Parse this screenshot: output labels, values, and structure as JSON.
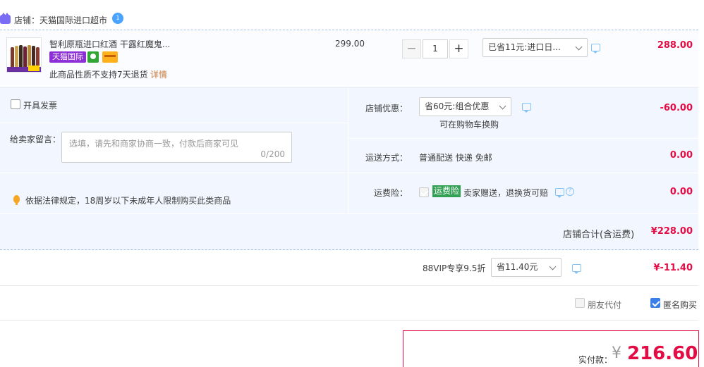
{
  "store": {
    "label": "店铺：天猫国际进口超市",
    "wangwang_badge": "1"
  },
  "item": {
    "title": "智利原瓶进口红酒 干露红魔鬼...",
    "badge_tmall": "天猫国际",
    "no_return_notice": "此商品性质不支持7天退货",
    "detail_link": "详情",
    "unit_price": "299.00",
    "qty_minus": "−",
    "quantity": "1",
    "qty_plus": "+",
    "promo_select": "已省11元:进口日...",
    "subtotal": "288.00"
  },
  "options": {
    "invoice_label": "开具发票",
    "message_label": "给卖家留言：",
    "message_placeholder": "选填，请先和商家协商一致，付款后商家可见",
    "message_count": "0/200",
    "age_notice": "依据法律规定，18周岁以下未成年人限制购买此类商品",
    "store_discount_label": "店铺优惠：",
    "store_discount_select": "省60元:组合优惠",
    "store_discount_note": "可在购物车换购",
    "store_discount_amount": "-60.00",
    "shipping_label": "运送方式：",
    "shipping_value": "普通配送 快递 免邮",
    "shipping_amount": "0.00",
    "freight_ins_label": "运费险：",
    "freight_ins_badge": "运费险",
    "freight_ins_value": "卖家赠送，退换货可赔",
    "freight_ins_amount": "0.00",
    "help_mark": "?",
    "store_total_label": "店铺合计(含运费)",
    "store_total_amount": "¥228.00"
  },
  "vip": {
    "label": "88VIP专享9.5折",
    "select": "省11.40元",
    "amount": "¥-11.40"
  },
  "purchase_options": {
    "friend_pay": "朋友代付",
    "anonymous": "匿名购买",
    "anonymous_checked": true
  },
  "payment": {
    "label": "实付款：",
    "currency": "¥",
    "amount": "216.60"
  },
  "colors": {
    "accent_red": "#e40c44",
    "tmall_purple": "#8d2fd6",
    "panel_blue": "#f2f7ff",
    "check_blue": "#3a7ee8"
  }
}
